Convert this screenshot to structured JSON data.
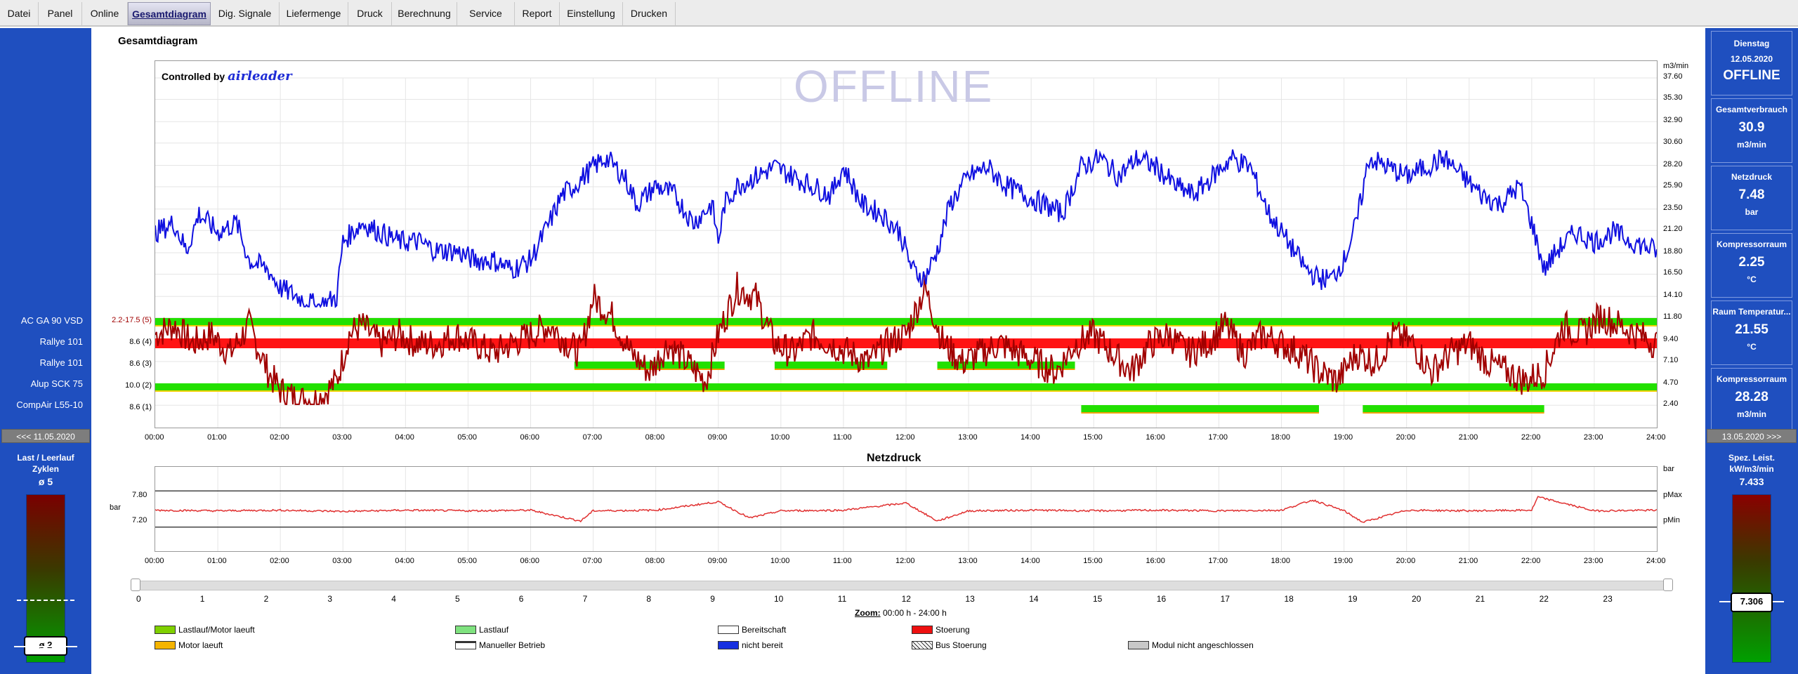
{
  "menu": [
    "Datei",
    "Panel",
    "Online",
    "Gesamtdiagram",
    "Dig. Signale",
    "Liefermenge",
    "Druck",
    "Berechnung",
    "Service",
    "Report",
    "Einstellung",
    "Drucken"
  ],
  "main_title": "Gesamtdiagram",
  "watermark": "OFFLINE",
  "controlled_by": "Controlled by",
  "brand": "airleader",
  "y_unit_right": "m3/min",
  "y_ticks_right": [
    "37.60",
    "35.30",
    "32.90",
    "30.60",
    "28.20",
    "25.90",
    "23.50",
    "21.20",
    "18.80",
    "16.50",
    "14.10",
    "11.80",
    "9.40",
    "7.10",
    "4.70",
    "2.40"
  ],
  "x_ticks": [
    "00:00",
    "01:00",
    "02:00",
    "03:00",
    "04:00",
    "05:00",
    "06:00",
    "07:00",
    "08:00",
    "09:00",
    "10:00",
    "11:00",
    "12:00",
    "13:00",
    "14:00",
    "15:00",
    "16:00",
    "17:00",
    "18:00",
    "19:00",
    "20:00",
    "21:00",
    "22:00",
    "23:00",
    "24:00"
  ],
  "compressors": [
    {
      "name": "AC GA 90 VSD",
      "value": "2.2-17.5 (5)"
    },
    {
      "name": "Rallye 101",
      "value": "8.6 (4)"
    },
    {
      "name": "Rallye 101",
      "value": "8.6 (3)"
    },
    {
      "name": "Alup SCK 75",
      "value": "10.0 (2)"
    },
    {
      "name": "CompAir L55-10",
      "value": "8.6 (1)"
    }
  ],
  "left": {
    "prev_date": "<<< 11.05.2020",
    "gauge_title_1": "Last / Leerlauf",
    "gauge_title_2": "Zyklen",
    "gauge_avg": "ø 5",
    "gauge_value": "ø 2"
  },
  "right": {
    "weekday": "Dienstag",
    "date": "12.05.2020",
    "status": "OFFLINE",
    "boxes": [
      {
        "title": "Gesamtverbrauch",
        "value": "30.9",
        "unit": "m3/min"
      },
      {
        "title": "Netzdruck",
        "value": "7.48",
        "unit": "bar"
      },
      {
        "title": "Kompressorraum",
        "value": "2.25",
        "unit": "°C"
      },
      {
        "title": "Raum Temperatur...",
        "value": "21.55",
        "unit": "°C"
      },
      {
        "title": "Kompressorraum",
        "value": "28.28",
        "unit": "m3/min"
      }
    ],
    "next_date": "13.05.2020 >>>",
    "gauge_title_1": "Spez. Leist.",
    "gauge_title_2": "kW/m3/min",
    "gauge_top": "7.433",
    "gauge_value": "7.306"
  },
  "netz": {
    "title": "Netzdruck",
    "unit_left": "bar",
    "unit_right": "bar",
    "y_ticks_left": [
      "7.80",
      "7.20"
    ],
    "pmax": "pMax",
    "pmin": "pMin"
  },
  "zoom": {
    "ticks": [
      "0",
      "1",
      "2",
      "3",
      "4",
      "5",
      "6",
      "7",
      "8",
      "9",
      "10",
      "11",
      "12",
      "13",
      "14",
      "15",
      "16",
      "17",
      "18",
      "19",
      "20",
      "21",
      "22",
      "23"
    ],
    "label": "Zoom:",
    "range": "00:00 h - 24:00 h"
  },
  "legend": [
    {
      "label": "Lastlauf/Motor laeuft",
      "color": "#7fd000"
    },
    {
      "label": "Motor laeuft",
      "color": "#f5b400"
    },
    {
      "label": "Lastlauf",
      "color": "#7fe27f"
    },
    {
      "label": "Manueller Betrieb",
      "color": "#ffffff"
    },
    {
      "label": "Bereitschaft",
      "color": "#ffffff"
    },
    {
      "label": "nicht bereit",
      "color": "#1730e0"
    },
    {
      "label": "Stoerung",
      "color": "#ee1010"
    },
    {
      "label": "Bus Stoerung",
      "color": "#ffffff"
    },
    {
      "label": "Modul nicht angeschlossen",
      "color": "#c8c8c8"
    }
  ],
  "colors": {
    "sidebar": "#1f4fbf",
    "flow_line": "#1010e0",
    "pressure_line": "#a00000",
    "run_bar": "#22e000",
    "fault_bar": "#ff1414",
    "netz_line": "#e03030"
  },
  "chart_data": [
    {
      "type": "line",
      "title": "Gesamtdiagram",
      "ylabel": "m3/min",
      "ylim": [
        0,
        37.6
      ],
      "x_unit": "h",
      "series": [
        {
          "name": "Gesamtverbrauch",
          "color": "#1010e0",
          "x": [
            0,
            0.3,
            0.5,
            0.7,
            1,
            1.3,
            1.5,
            1.8,
            2,
            2.3,
            2.6,
            2.9,
            3,
            3.3,
            3.6,
            3.9,
            4.2,
            4.5,
            4.8,
            5.1,
            5.4,
            5.7,
            6,
            6.3,
            6.5,
            6.7,
            7,
            7.2,
            7.5,
            7.7,
            8,
            8.3,
            8.6,
            8.9,
            9,
            9.1,
            9.3,
            9.6,
            9.9,
            10.2,
            10.5,
            10.8,
            11,
            11.3,
            11.6,
            11.9,
            12.1,
            12.3,
            12.5,
            12.7,
            13,
            13.3,
            13.6,
            13.9,
            14.2,
            14.5,
            14.8,
            15.1,
            15.4,
            15.7,
            16,
            16.3,
            16.6,
            16.9,
            17.2,
            17.5,
            17.8,
            18,
            18.2,
            18.4,
            18.6,
            18.8,
            19,
            19.2,
            19.4,
            19.7,
            20,
            20.3,
            20.6,
            20.9,
            21.2,
            21.5,
            21.8,
            22,
            22.2,
            22.4,
            22.7,
            23,
            23.3,
            23.6,
            24
          ],
          "y": [
            21,
            22,
            19,
            23,
            21,
            22,
            18,
            17,
            15,
            14,
            13,
            14,
            20,
            22,
            21,
            20,
            20,
            19,
            19,
            18,
            18,
            17,
            18,
            22,
            25,
            26,
            28,
            29,
            27,
            24,
            26,
            25,
            22,
            24,
            20,
            24,
            26,
            27,
            28,
            27,
            26,
            25,
            28,
            24,
            23,
            21,
            17,
            16,
            19,
            24,
            27,
            28,
            26,
            25,
            24,
            23,
            28,
            29,
            27,
            29,
            28,
            26,
            25,
            27,
            29,
            28,
            23,
            21,
            19,
            17,
            16,
            16,
            18,
            22,
            29,
            28,
            27,
            28,
            29,
            27,
            25,
            24,
            26,
            22,
            17,
            19,
            21,
            20,
            21,
            20,
            19
          ]
        },
        {
          "name": "Druck",
          "color": "#a00000",
          "x": [
            0,
            0.3,
            0.6,
            0.9,
            1.2,
            1.5,
            1.8,
            2,
            2.3,
            2.6,
            2.9,
            3.1,
            3.3,
            3.6,
            3.9,
            4.2,
            4.5,
            4.8,
            5.1,
            5.4,
            5.7,
            6,
            6.3,
            6.6,
            6.8,
            7,
            7.3,
            7.6,
            7.9,
            8.2,
            8.5,
            8.8,
            9,
            9.3,
            9.6,
            9.9,
            10.2,
            10.5,
            10.8,
            11.1,
            11.4,
            11.7,
            12,
            12.3,
            12.6,
            12.9,
            13.2,
            13.5,
            13.8,
            14.1,
            14.4,
            14.7,
            15,
            15.3,
            15.6,
            15.9,
            16.2,
            16.5,
            16.8,
            17.1,
            17.4,
            17.7,
            18,
            18.3,
            18.6,
            18.9,
            19.2,
            19.5,
            19.8,
            20.1,
            20.4,
            20.7,
            21,
            21.3,
            21.6,
            21.9,
            22.2,
            22.5,
            22.8,
            23.1,
            23.4,
            23.7,
            24
          ],
          "y": [
            10,
            11,
            9,
            10,
            8,
            11,
            6,
            4,
            3,
            3,
            5,
            10,
            11,
            9,
            10,
            9,
            9,
            10,
            9,
            8,
            9,
            10,
            11,
            9,
            8,
            14,
            12,
            8,
            6,
            9,
            7,
            5,
            10,
            15,
            14,
            9,
            8,
            10,
            9,
            8,
            7,
            9,
            10,
            15,
            9,
            7,
            8,
            9,
            8,
            7,
            6,
            9,
            10,
            8,
            6,
            9,
            10,
            8,
            9,
            11,
            8,
            10,
            9,
            8,
            6,
            5,
            8,
            7,
            10,
            9,
            6,
            8,
            9,
            7,
            6,
            5,
            6,
            11,
            10,
            12,
            11,
            10,
            9
          ]
        }
      ]
    },
    {
      "type": "line",
      "title": "Netzdruck",
      "ylabel": "bar",
      "ylim": [
        6.8,
        8.2
      ],
      "x_unit": "h",
      "series": [
        {
          "name": "Netzdruck",
          "color": "#e03030",
          "x": [
            0,
            1,
            2,
            3,
            4,
            5,
            6,
            6.8,
            7,
            8,
            9,
            9.5,
            10,
            11,
            12,
            12.5,
            13,
            14,
            15,
            16,
            17,
            18,
            18.5,
            19,
            19.3,
            20,
            21,
            22,
            22.1,
            23,
            24
          ],
          "y": [
            7.48,
            7.47,
            7.48,
            7.46,
            7.48,
            7.47,
            7.48,
            7.3,
            7.47,
            7.48,
            7.62,
            7.35,
            7.47,
            7.48,
            7.6,
            7.3,
            7.47,
            7.48,
            7.47,
            7.48,
            7.47,
            7.48,
            7.65,
            7.47,
            7.28,
            7.48,
            7.47,
            7.48,
            7.7,
            7.47,
            7.48
          ]
        }
      ],
      "pmax": 7.8,
      "pmin": 7.2
    }
  ]
}
